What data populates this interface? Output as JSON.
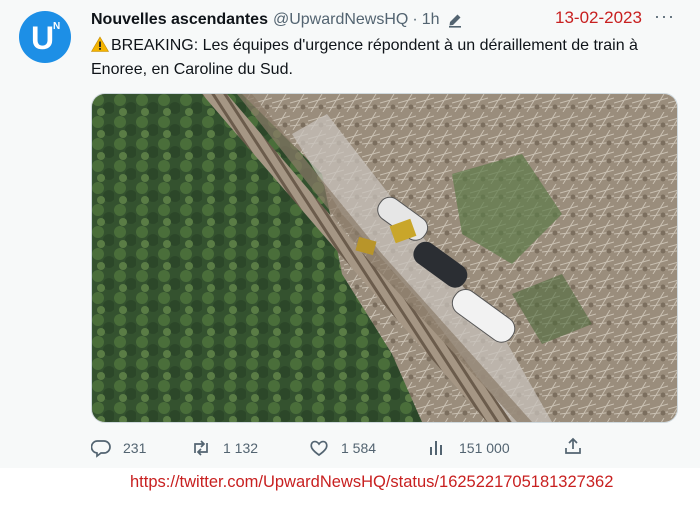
{
  "tweet": {
    "author_name": "Nouvelles ascendantes",
    "handle": "@UpwardNewsHQ",
    "separator": "·",
    "time": "1h",
    "date_overlay": "13-02-2023",
    "text": "BREAKING: Les équipes d'urgence répondent à un déraillement de train à Enoree, en Caroline du Sud.",
    "avatar_letters": {
      "main": "U",
      "small": "N"
    },
    "icons": {
      "avatar": "upward-news-logo",
      "edit": "pen-icon",
      "warning": "warning-emoji",
      "more": "more-icon",
      "reply": "reply-icon",
      "retweet": "retweet-icon",
      "like": "like-icon",
      "views": "views-icon",
      "share": "share-icon"
    },
    "media": {
      "kind": "aerial photo of derailed tank cars on a railway through a forest"
    },
    "stats": {
      "replies": "231",
      "retweets": "1 132",
      "likes": "1 584",
      "views": "151 000"
    }
  },
  "source_url": "https://twitter.com/UpwardNewsHQ/status/1625221705181327362",
  "colors": {
    "date": "#c82020",
    "url": "#c82020",
    "avatar": "#1d8fe6",
    "secondary": "#536471"
  }
}
